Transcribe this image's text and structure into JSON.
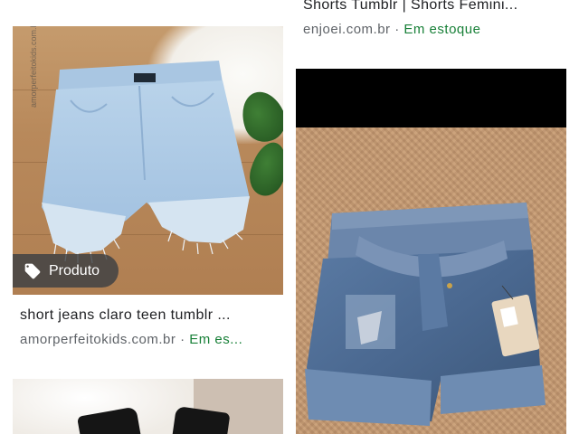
{
  "results": [
    {
      "column": "right",
      "title": "Shorts Tumblr | Shorts Femini...",
      "domain": "enjoei.com.br",
      "separator": " · ",
      "availability": "Em estoque"
    },
    {
      "column": "left",
      "image_watermark": "amorperfeitokids.com.br",
      "badge": {
        "icon": "tag-icon",
        "label": "Produto"
      },
      "title": "short jeans claro teen tumblr ...",
      "domain": "amorperfeitokids.com.br",
      "separator": " · ",
      "availability": "Em es..."
    },
    {
      "column": "right",
      "image_subject": "denim shorts with belt and price tag on carpet"
    },
    {
      "column": "left",
      "image_subject": "black item on white fur rug"
    }
  ],
  "colors": {
    "title": "#202124",
    "domain": "#5f6368",
    "availability": "#188038",
    "badge_bg": "#3c4043"
  }
}
